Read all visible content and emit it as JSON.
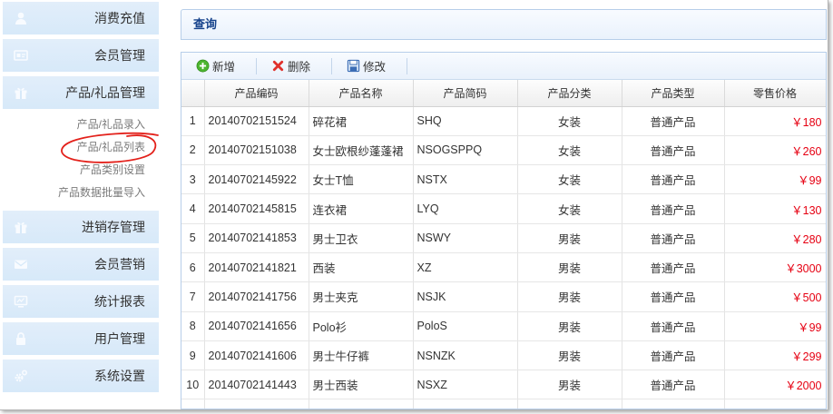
{
  "sidebar": {
    "items": [
      {
        "label": "消费充值",
        "icon": "user-icon"
      },
      {
        "label": "会员管理",
        "icon": "member-card-icon"
      },
      {
        "label": "产品/礼品管理",
        "icon": "gift-icon",
        "expanded": true,
        "children": [
          {
            "label": "产品/礼品录入"
          },
          {
            "label": "产品/礼品列表",
            "highlighted": true
          },
          {
            "label": "产品类别设置"
          },
          {
            "label": "产品数据批量导入"
          }
        ]
      },
      {
        "label": "进销存管理",
        "icon": "gift-box-icon"
      },
      {
        "label": "会员营销",
        "icon": "envelope-icon"
      },
      {
        "label": "统计报表",
        "icon": "monitor-chart-icon"
      },
      {
        "label": "用户管理",
        "icon": "lock-icon"
      },
      {
        "label": "系统设置",
        "icon": "gear-icon"
      }
    ]
  },
  "query_panel": {
    "title": "查询"
  },
  "toolbar": {
    "add_label": "新增",
    "add_icon": "add-icon",
    "delete_label": "删除",
    "delete_icon": "delete-icon",
    "edit_label": "修改",
    "edit_icon": "save-icon"
  },
  "table": {
    "headers": [
      "产品编码",
      "产品名称",
      "产品简码",
      "产品分类",
      "产品类型",
      "零售价格"
    ],
    "rows": [
      {
        "no": "1",
        "code": "20140702151524",
        "name": "碎花裙",
        "short_code": "SHQ",
        "category": "女装",
        "type": "普通产品",
        "price": "￥180"
      },
      {
        "no": "2",
        "code": "20140702151038",
        "name": "女士欧根纱蓬蓬裙",
        "short_code": "NSOGSPPQ",
        "category": "女装",
        "type": "普通产品",
        "price": "￥260"
      },
      {
        "no": "3",
        "code": "20140702145922",
        "name": "女士T恤",
        "short_code": "NSTX",
        "category": "女装",
        "type": "普通产品",
        "price": "￥99"
      },
      {
        "no": "4",
        "code": "20140702145815",
        "name": "连衣裙",
        "short_code": "LYQ",
        "category": "女装",
        "type": "普通产品",
        "price": "￥130"
      },
      {
        "no": "5",
        "code": "20140702141853",
        "name": "男士卫衣",
        "short_code": "NSWY",
        "category": "男装",
        "type": "普通产品",
        "price": "￥280"
      },
      {
        "no": "6",
        "code": "20140702141821",
        "name": "西装",
        "short_code": "XZ",
        "category": "男装",
        "type": "普通产品",
        "price": "￥3000"
      },
      {
        "no": "7",
        "code": "20140702141756",
        "name": "男士夹克",
        "short_code": "NSJK",
        "category": "男装",
        "type": "普通产品",
        "price": "￥500"
      },
      {
        "no": "8",
        "code": "20140702141656",
        "name": "Polo衫",
        "short_code": "PoloS",
        "category": "男装",
        "type": "普通产品",
        "price": "￥99"
      },
      {
        "no": "9",
        "code": "20140702141606",
        "name": "男士牛仔裤",
        "short_code": "NSNZK",
        "category": "男装",
        "type": "普通产品",
        "price": "￥299"
      },
      {
        "no": "10",
        "code": "20140702141443",
        "name": "男士西装",
        "short_code": "NSXZ",
        "category": "男装",
        "type": "普通产品",
        "price": "￥2000"
      }
    ]
  },
  "colors": {
    "accent": "#15428b",
    "price": "#e60012",
    "sidebar_bar": "#d7e9f9",
    "annotation": "#e3211b",
    "add_icon": "#4db52f",
    "delete_icon": "#e0312c",
    "save_icon": "#3b6db5"
  }
}
